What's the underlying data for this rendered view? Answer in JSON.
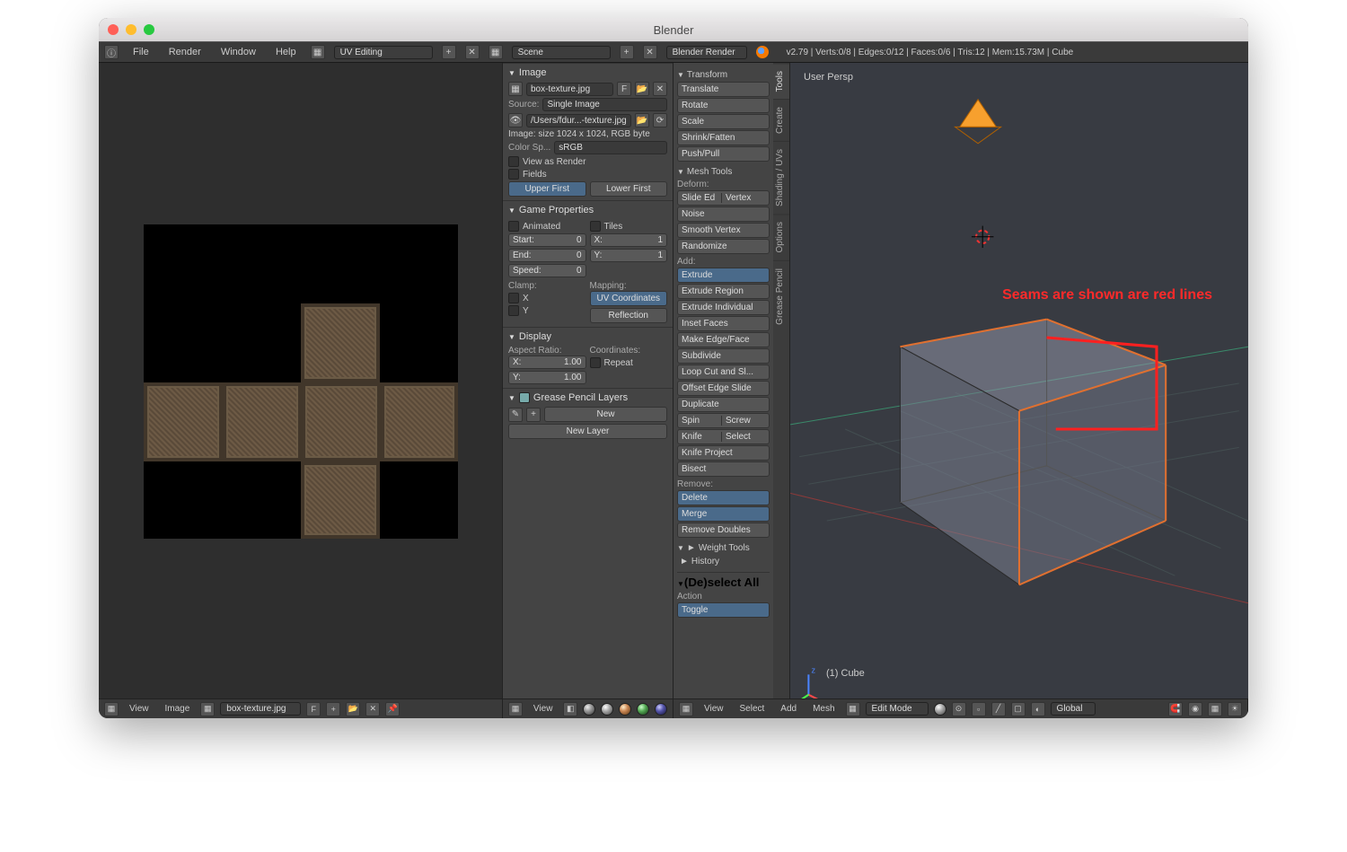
{
  "window": {
    "title": "Blender"
  },
  "topmenu": {
    "items": [
      "File",
      "Render",
      "Window",
      "Help"
    ],
    "layout": "UV Editing",
    "scene": "Scene",
    "engine": "Blender Render",
    "stats": "v2.79 | Verts:0/8 | Edges:0/12 | Faces:0/6 | Tris:12 | Mem:15.73M | Cube"
  },
  "npanel": {
    "image": {
      "title": "Image",
      "name": "box-texture.jpg",
      "fake_user": "F",
      "source_label": "Source:",
      "source": "Single Image",
      "path": "/Users/fdur...-texture.jpg",
      "info": "Image: size 1024 x 1024, RGB byte",
      "colorspace_label": "Color Sp...",
      "colorspace": "sRGB",
      "view_as_render": "View as Render",
      "fields": "Fields",
      "upper": "Upper First",
      "lower": "Lower First"
    },
    "game": {
      "title": "Game Properties",
      "animated": "Animated",
      "tiles": "Tiles",
      "start_l": "Start:",
      "start_v": "0",
      "end_l": "End:",
      "end_v": "0",
      "speed_l": "Speed:",
      "speed_v": "0",
      "x_l": "X:",
      "x_v": "1",
      "y_l": "Y:",
      "y_v": "1",
      "clamp": "Clamp:",
      "mapping": "Mapping:",
      "clamp_x": "X",
      "clamp_y": "Y",
      "uvcoords": "UV Coordinates",
      "reflection": "Reflection"
    },
    "display": {
      "title": "Display",
      "aspect": "Aspect Ratio:",
      "coords": "Coordinates:",
      "ax_l": "X:",
      "ax_v": "1.00",
      "ay_l": "Y:",
      "ay_v": "1.00",
      "repeat": "Repeat"
    },
    "gpencil": {
      "title": "Grease Pencil Layers",
      "new": "New",
      "newlayer": "New Layer"
    }
  },
  "tpanel": {
    "tabs": [
      "Tools",
      "Create",
      "Shading / UVs",
      "Options",
      "Grease Pencil"
    ],
    "transform": {
      "title": "Transform",
      "items": [
        "Translate",
        "Rotate",
        "Scale",
        "Shrink/Fatten",
        "Push/Pull"
      ]
    },
    "meshtools": {
      "title": "Mesh Tools",
      "deform_label": "Deform:",
      "slide_edge": "Slide Ed",
      "slide_vertex": "Vertex",
      "deform_items": [
        "Noise",
        "Smooth Vertex",
        "Randomize"
      ],
      "add_label": "Add:",
      "extrude": "Extrude",
      "add_items": [
        "Extrude Region",
        "Extrude Individual",
        "Inset Faces",
        "Make Edge/Face",
        "Subdivide",
        "Loop Cut and Sl...",
        "Offset Edge Slide",
        "Duplicate"
      ],
      "spin": "Spin",
      "screw": "Screw",
      "knife": "Knife",
      "select": "Select",
      "knife_project": "Knife Project",
      "bisect": "Bisect",
      "remove_label": "Remove:",
      "delete": "Delete",
      "merge": "Merge",
      "remove_doubles": "Remove Doubles"
    },
    "weight": {
      "title": "Weight Tools"
    },
    "history": {
      "title": "History"
    },
    "deselect": {
      "title": "(De)select All",
      "action_label": "Action",
      "action": "Toggle"
    }
  },
  "viewport": {
    "persp": "User Persp",
    "object": "(1) Cube",
    "annotation": "Seams are shown are red lines"
  },
  "footers": {
    "uv": {
      "view": "View",
      "image": "Image",
      "name": "box-texture.jpg",
      "fake": "F",
      "view2": "View"
    },
    "vp": {
      "view": "View",
      "select": "Select",
      "add": "Add",
      "mesh": "Mesh",
      "mode": "Edit Mode",
      "orient": "Global"
    }
  }
}
